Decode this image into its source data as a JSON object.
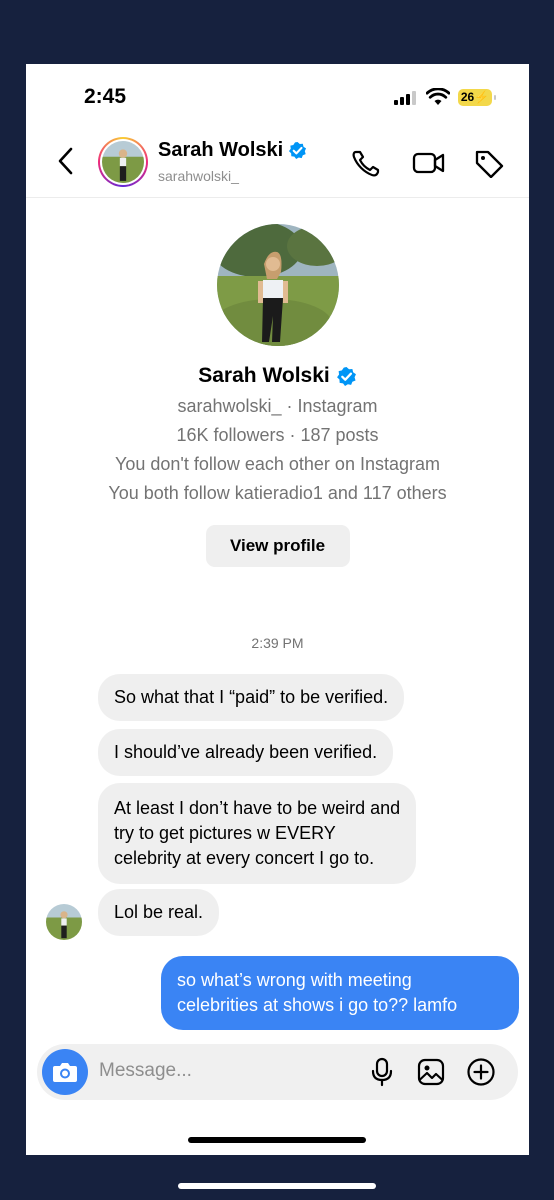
{
  "status_bar": {
    "time": "2:45",
    "battery": "26"
  },
  "header": {
    "name": "Sarah Wolski",
    "username": "sarahwolski_"
  },
  "profile": {
    "name": "Sarah Wolski",
    "handle_line": "sarahwolski_ · Instagram",
    "stats_line": "16K followers · 187 posts",
    "follow_line": "You don't follow each other on Instagram",
    "mutual_line": "You both follow katieradio1 and 117 others",
    "view_profile_label": "View profile"
  },
  "chat": {
    "timestamp": "2:39 PM",
    "messages": [
      {
        "from": "them",
        "text": "So what that I “paid” to be verified."
      },
      {
        "from": "them",
        "text": "I should’ve already been verified."
      },
      {
        "from": "them",
        "lines": [
          "At least I don’t have to be weird and",
          "try to get pictures w EVERY",
          "celebrity at every concert I go to."
        ]
      },
      {
        "from": "them",
        "text": "Lol be real."
      },
      {
        "from": "me",
        "lines": [
          "so what’s wrong with meeting",
          "celebrities at shows i go to?? lamfo"
        ]
      }
    ]
  },
  "composer": {
    "placeholder": "Message..."
  },
  "icons": [
    "back-icon",
    "verified-icon",
    "phone-icon",
    "video-icon",
    "tag-icon",
    "camera-icon",
    "microphone-icon",
    "gallery-icon",
    "plus-icon"
  ],
  "colors": {
    "accent": "#3a84f4",
    "incoming_bubble": "#efefef",
    "background_frame": "#16213e",
    "battery": "#f3d84a"
  }
}
